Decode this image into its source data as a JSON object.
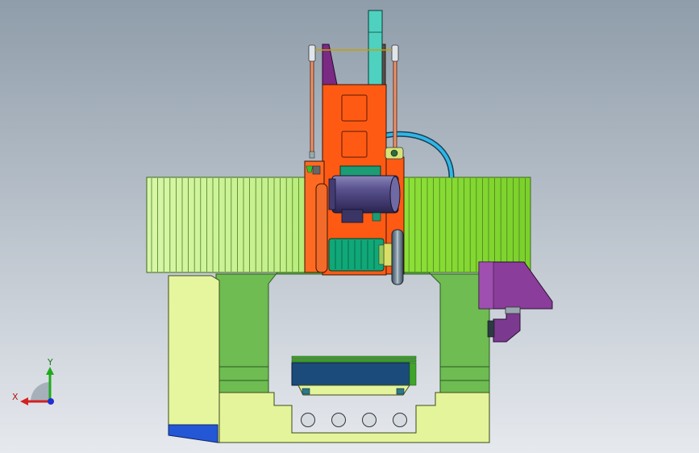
{
  "viewport": {
    "background_top": "#8f9daa",
    "background_bottom": "#e6e9ee"
  },
  "triad": {
    "x_label": "X",
    "y_label": "Y",
    "x_color": "#d42020",
    "y_color": "#1faa1f",
    "z_color": "#1f2fd0"
  },
  "colors": {
    "base": "#e3f49a",
    "frame_green": "#6cbb4f",
    "column_orange": "#ff5a14",
    "motor_purple": "#514a82",
    "spindle_teal": "#10a878",
    "bellows_left": "#c6f28d",
    "bellows_right": "#8fe83a",
    "hood_purple": "#8a3d9a",
    "pipe_blue": "#1da7d8",
    "table_blue": "#1b4b7a",
    "side_block_blue": "#2457d6"
  }
}
